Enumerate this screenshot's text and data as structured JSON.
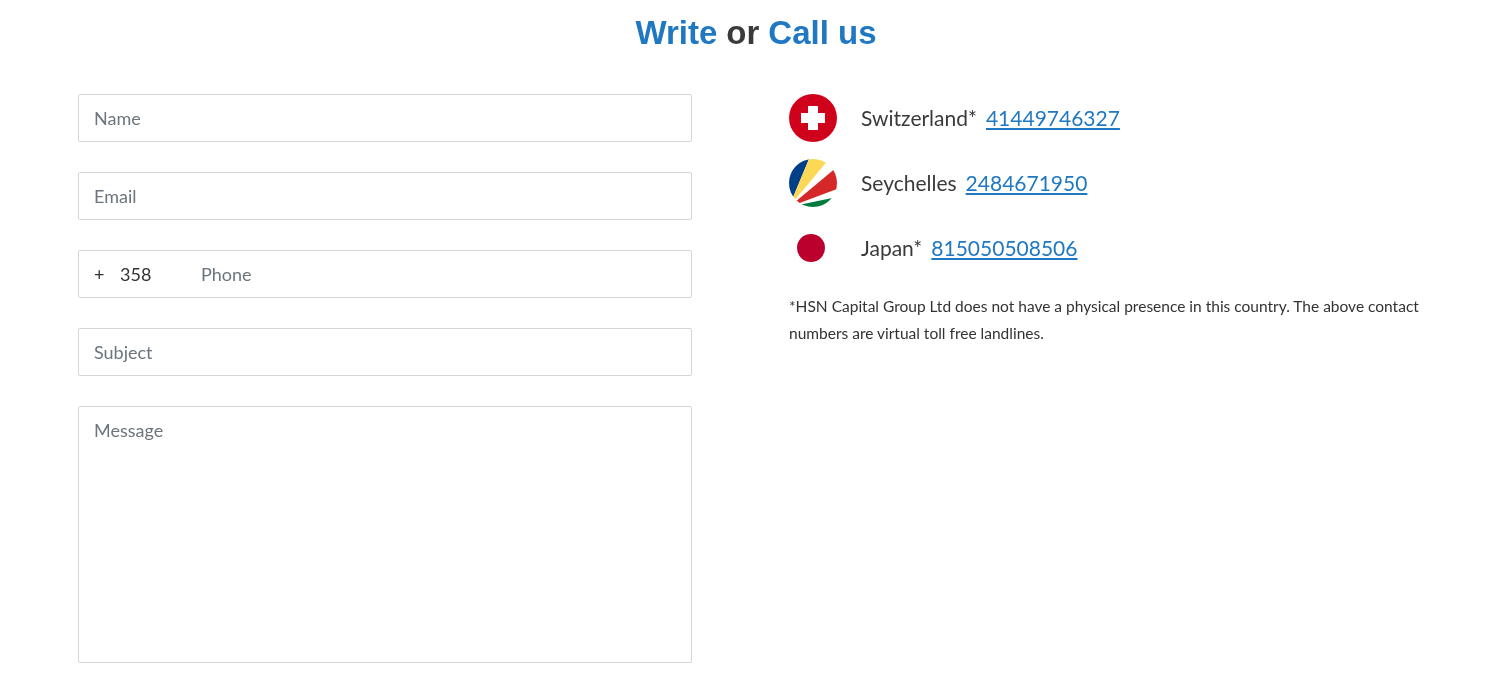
{
  "heading": [
    {
      "text": "Write",
      "accent": true
    },
    {
      "text": "or",
      "accent": false
    },
    {
      "text": "Call us",
      "accent": true
    }
  ],
  "form": {
    "fields": [
      {
        "kind": "text",
        "placeholder": "Name"
      },
      {
        "kind": "text",
        "placeholder": "Email"
      },
      {
        "kind": "phone",
        "prefix": "+",
        "code": "358",
        "placeholder": "Phone"
      },
      {
        "kind": "text",
        "placeholder": "Subject"
      },
      {
        "kind": "textarea",
        "placeholder": "Message"
      }
    ]
  },
  "contacts": [
    {
      "kind": "switzerland",
      "country": "Switzerland*",
      "number": "41449746327"
    },
    {
      "kind": "seychelles",
      "country": "Seychelles",
      "number": "2484671950"
    },
    {
      "kind": "japan",
      "country": "Japan*",
      "number": "815050508506"
    }
  ],
  "note": "*HSN Capital Group Ltd does not have a physical presence in this country. The above contact numbers are virtual toll free landlines."
}
